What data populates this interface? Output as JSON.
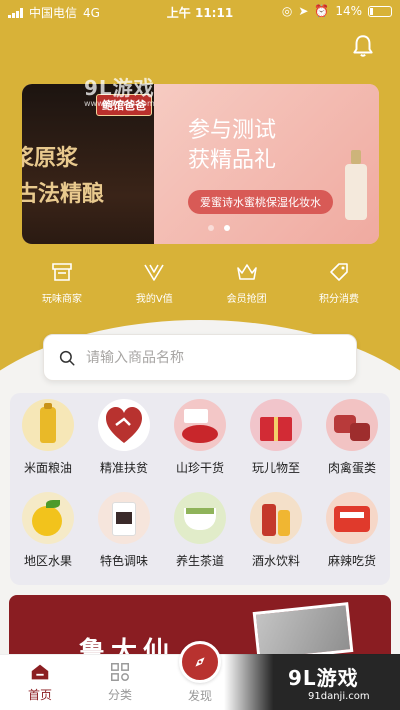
{
  "status_bar": {
    "carrier": "中国电信",
    "network": "4G",
    "time": "上午 11:11",
    "battery": "14%"
  },
  "watermark_top": {
    "brand": "9L游戏",
    "site": "www.91danji.com"
  },
  "banner": {
    "brand": "鲍馆爸爸",
    "left_line1": "浆原浆",
    "left_line2": "古法精酿",
    "title_line1": "参与测试",
    "title_line2": "获精品礼",
    "pill": "爱蜜诗水蜜桃保湿化妆水"
  },
  "quick_links": [
    {
      "label": "玩味商家",
      "icon": "shop-icon"
    },
    {
      "label": "我的V值",
      "icon": "v-value-icon"
    },
    {
      "label": "会员抢团",
      "icon": "crown-icon"
    },
    {
      "label": "积分消费",
      "icon": "tag-icon"
    }
  ],
  "search": {
    "placeholder": "请输入商品名称"
  },
  "categories": [
    {
      "label": "米面粮油",
      "icon": "oil-bottle-icon",
      "color": "#f6e7b7"
    },
    {
      "label": "精准扶贫",
      "icon": "heart-hands-icon",
      "color": "#b8322f"
    },
    {
      "label": "山珍干货",
      "icon": "goji-icon",
      "color": "#f3c7c7"
    },
    {
      "label": "玩儿物至",
      "icon": "gift-box-icon",
      "color": "#f1c5cb"
    },
    {
      "label": "肉禽蛋类",
      "icon": "meat-icon",
      "color": "#f2c3c3"
    },
    {
      "label": "地区水果",
      "icon": "fruit-icon",
      "color": "#f5eac7"
    },
    {
      "label": "特色调味",
      "icon": "seasoning-jar-icon",
      "color": "#f6e5dc"
    },
    {
      "label": "养生茶道",
      "icon": "tea-cup-icon",
      "color": "#e1ecc9"
    },
    {
      "label": "酒水饮料",
      "icon": "drinks-icon",
      "color": "#f4e0c9"
    },
    {
      "label": "麻辣吃货",
      "icon": "spicy-snack-icon",
      "color": "#f6d7c8"
    }
  ],
  "promo": {
    "text": "鲁大仙"
  },
  "tabs": [
    {
      "label": "首页",
      "icon": "home-icon",
      "active": true
    },
    {
      "label": "分类",
      "icon": "grid-icon",
      "active": false
    },
    {
      "label": "发现",
      "icon": "compass-icon",
      "active": false
    }
  ],
  "watermark_bottom": {
    "brand": "9L游戏",
    "site": "91danji.com"
  },
  "colors": {
    "header_gold": "#d8b238",
    "brand_red": "#8b1e22",
    "discover_red": "#b8322f"
  }
}
